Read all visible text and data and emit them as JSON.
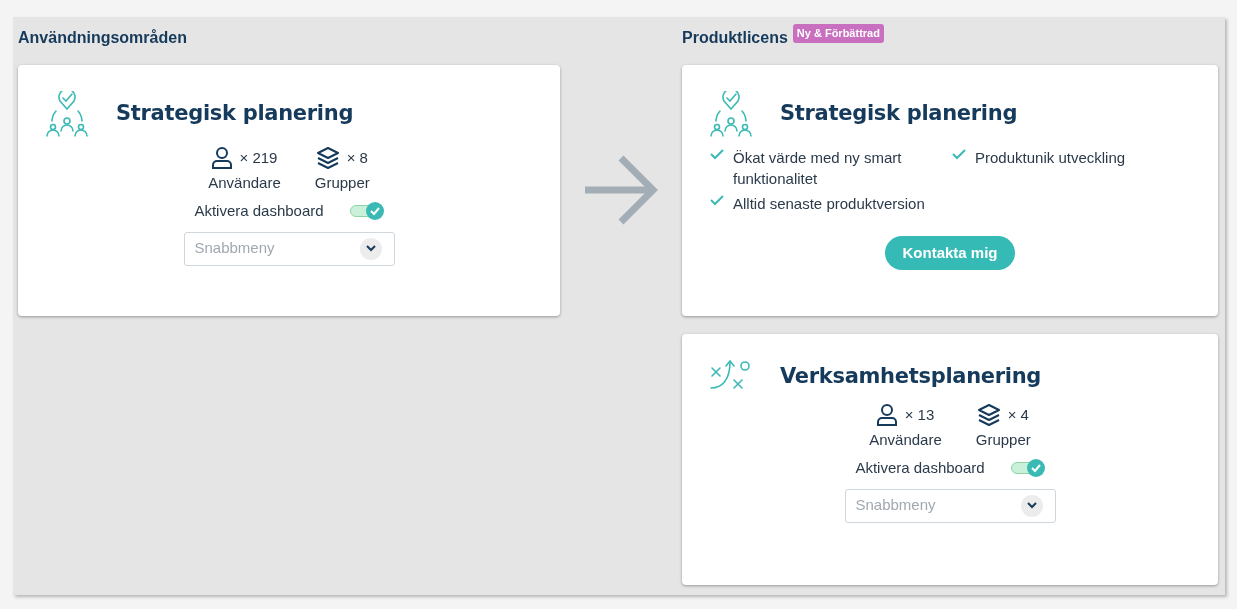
{
  "left": {
    "heading": "Användningsområden",
    "cards": [
      {
        "kind": "usage",
        "title": "Strategisk planering",
        "stats": [
          {
            "kind": "users",
            "count": "× 219",
            "label": "Användare"
          },
          {
            "kind": "groups",
            "count": "× 8",
            "label": "Grupper"
          }
        ],
        "toggle": {
          "label": "Aktivera dashboard",
          "on": true
        },
        "dropdown": {
          "placeholder": "Snabbmeny"
        }
      }
    ]
  },
  "right": {
    "heading": "Produktlicens",
    "badge": "Ny & Förbättrad",
    "cards": [
      {
        "kind": "offer",
        "title": "Strategisk planering",
        "features": [
          "Ökat värde med ny smart funktionalitet",
          "Produktunik utveckling",
          "Alltid senaste produktversion"
        ],
        "button": "Kontakta mig"
      },
      {
        "kind": "usage",
        "title": "Verksamhetsplanering",
        "stats": [
          {
            "kind": "users",
            "count": "× 13",
            "label": "Användare"
          },
          {
            "kind": "groups",
            "count": "× 4",
            "label": "Grupper"
          }
        ],
        "toggle": {
          "label": "Aktivera dashboard",
          "on": true
        },
        "dropdown": {
          "placeholder": "Snabbmeny"
        }
      }
    ]
  }
}
